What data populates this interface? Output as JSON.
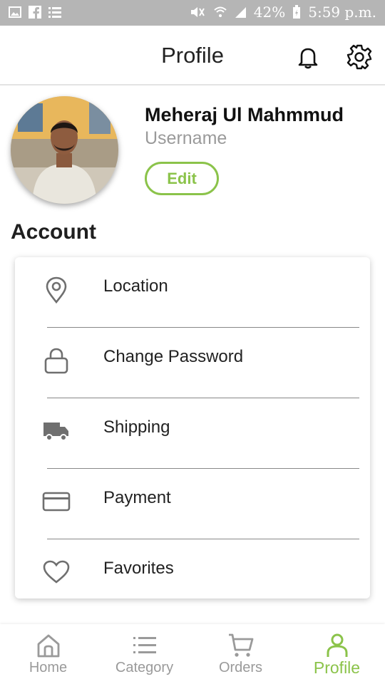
{
  "status_bar": {
    "left_icons": [
      "image-icon",
      "facebook-icon",
      "list-icon"
    ],
    "right_icons": [
      "mute-icon",
      "wifi-icon",
      "signal-icon"
    ],
    "battery": "42%",
    "time": "5:59 p.m."
  },
  "header": {
    "title": "Profile",
    "icons": [
      "bell-icon",
      "gear-icon"
    ]
  },
  "profile": {
    "name": "Meheraj Ul Mahmmud",
    "username": "Username",
    "edit_label": "Edit"
  },
  "account": {
    "title": "Account",
    "items": [
      {
        "label": "Location",
        "icon": "location-pin-icon"
      },
      {
        "label": "Change Password",
        "icon": "lock-icon"
      },
      {
        "label": "Shipping",
        "icon": "truck-icon"
      },
      {
        "label": "Payment",
        "icon": "credit-card-icon"
      },
      {
        "label": "Favorites",
        "icon": "heart-icon"
      }
    ]
  },
  "bottom_nav": {
    "items": [
      {
        "label": "Home",
        "icon": "home-icon",
        "active": false
      },
      {
        "label": "Category",
        "icon": "list-icon",
        "active": false
      },
      {
        "label": "Orders",
        "icon": "cart-icon",
        "active": false
      },
      {
        "label": "Profile",
        "icon": "user-icon",
        "active": true
      }
    ]
  },
  "colors": {
    "accent": "#8bc34a",
    "muted": "#9a9a9a",
    "status_bar": "#b5b5b5"
  }
}
